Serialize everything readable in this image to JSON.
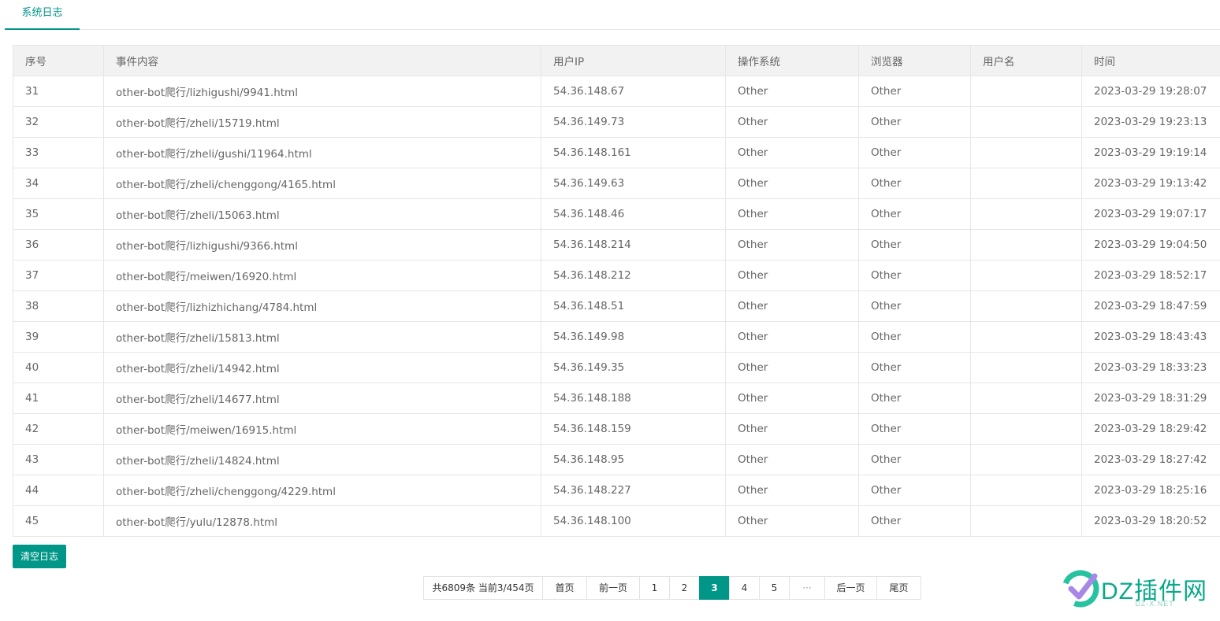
{
  "tab": {
    "label": "系统日志"
  },
  "table": {
    "headers": [
      "序号",
      "事件内容",
      "用户IP",
      "操作系统",
      "浏览器",
      "用户名",
      "时间"
    ],
    "rows": [
      [
        "31",
        "other-bot爬行/lizhigushi/9941.html",
        "54.36.148.67",
        "Other",
        "Other",
        "",
        "2023-03-29 19:28:07"
      ],
      [
        "32",
        "other-bot爬行/zheli/15719.html",
        "54.36.149.73",
        "Other",
        "Other",
        "",
        "2023-03-29 19:23:13"
      ],
      [
        "33",
        "other-bot爬行/zheli/gushi/11964.html",
        "54.36.148.161",
        "Other",
        "Other",
        "",
        "2023-03-29 19:19:14"
      ],
      [
        "34",
        "other-bot爬行/zheli/chenggong/4165.html",
        "54.36.149.63",
        "Other",
        "Other",
        "",
        "2023-03-29 19:13:42"
      ],
      [
        "35",
        "other-bot爬行/zheli/15063.html",
        "54.36.148.46",
        "Other",
        "Other",
        "",
        "2023-03-29 19:07:17"
      ],
      [
        "36",
        "other-bot爬行/lizhigushi/9366.html",
        "54.36.148.214",
        "Other",
        "Other",
        "",
        "2023-03-29 19:04:50"
      ],
      [
        "37",
        "other-bot爬行/meiwen/16920.html",
        "54.36.148.212",
        "Other",
        "Other",
        "",
        "2023-03-29 18:52:17"
      ],
      [
        "38",
        "other-bot爬行/lizhizhichang/4784.html",
        "54.36.148.51",
        "Other",
        "Other",
        "",
        "2023-03-29 18:47:59"
      ],
      [
        "39",
        "other-bot爬行/zheli/15813.html",
        "54.36.149.98",
        "Other",
        "Other",
        "",
        "2023-03-29 18:43:43"
      ],
      [
        "40",
        "other-bot爬行/zheli/14942.html",
        "54.36.149.35",
        "Other",
        "Other",
        "",
        "2023-03-29 18:33:23"
      ],
      [
        "41",
        "other-bot爬行/zheli/14677.html",
        "54.36.148.188",
        "Other",
        "Other",
        "",
        "2023-03-29 18:31:29"
      ],
      [
        "42",
        "other-bot爬行/meiwen/16915.html",
        "54.36.148.159",
        "Other",
        "Other",
        "",
        "2023-03-29 18:29:42"
      ],
      [
        "43",
        "other-bot爬行/zheli/14824.html",
        "54.36.148.95",
        "Other",
        "Other",
        "",
        "2023-03-29 18:27:42"
      ],
      [
        "44",
        "other-bot爬行/zheli/chenggong/4229.html",
        "54.36.148.227",
        "Other",
        "Other",
        "",
        "2023-03-29 18:25:16"
      ],
      [
        "45",
        "other-bot爬行/yulu/12878.html",
        "54.36.148.100",
        "Other",
        "Other",
        "",
        "2023-03-29 18:20:52"
      ]
    ]
  },
  "clear_button": {
    "label": "清空日志"
  },
  "pagination": {
    "info": "共6809条 当前3/454页",
    "first": "首页",
    "prev": "前一页",
    "pages": [
      "1",
      "2",
      "3",
      "4",
      "5"
    ],
    "current": "3",
    "ellipsis": "···",
    "next": "后一页",
    "last": "尾页"
  },
  "watermark": {
    "text": "DZ插件网",
    "subtext": "DZ-X.NET"
  },
  "colors": {
    "accent": "#009688",
    "border": "#e6e6e6",
    "header_bg": "#f2f2f2",
    "text": "#666666"
  }
}
